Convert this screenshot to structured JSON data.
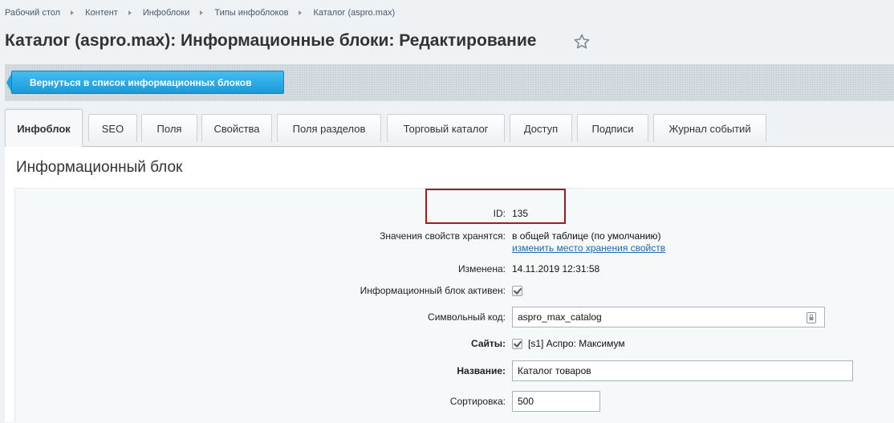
{
  "breadcrumb": [
    "Рабочий стол",
    "Контент",
    "Инфоблоки",
    "Типы инфоблоков",
    "Каталог (aspro.max)"
  ],
  "page_title": "Каталог (aspro.max): Информационные блоки: Редактирование",
  "toolbar": {
    "back_label": "Вернуться в список информационных блоков"
  },
  "tabs": [
    "Инфоблок",
    "SEO",
    "Поля",
    "Свойства",
    "Поля разделов",
    "Торговый каталог",
    "Доступ",
    "Подписи",
    "Журнал событий"
  ],
  "active_tab": "Инфоблок",
  "section_title": "Информационный блок",
  "form": {
    "id_label": "ID:",
    "id_value": "135",
    "storage_label": "Значения свойств хранятся:",
    "storage_value": "в общей таблице (по умолчанию)",
    "storage_link": "изменить место хранения свойств",
    "modified_label": "Изменена:",
    "modified_value": "14.11.2019 12:31:58",
    "active_label": "Информационный блок активен:",
    "active_checked": true,
    "code_label": "Символьный код:",
    "code_value": "aspro_max_catalog",
    "sites_label": "Сайты:",
    "sites_value": "[s1] Аспро: Максимум",
    "sites_checked": true,
    "name_label": "Название:",
    "name_value": "Каталог товаров",
    "sort_label": "Сортировка:",
    "sort_value": "500"
  },
  "colors": {
    "accent": "#1a9ad9",
    "link": "#2067b0",
    "highlight": "#a01d1d"
  },
  "icons": {
    "favorite": "star-outline-icon",
    "code_field": "lock-icon"
  }
}
